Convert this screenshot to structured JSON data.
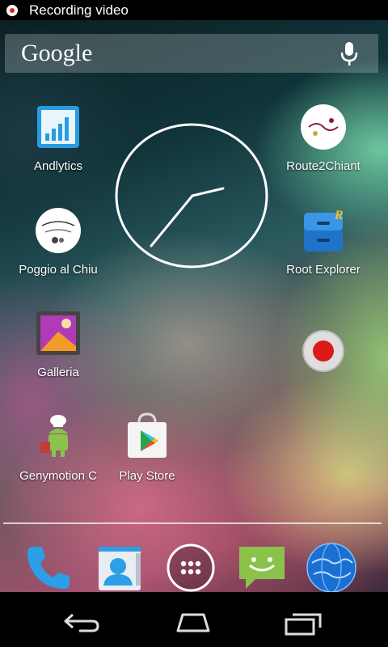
{
  "statusbar": {
    "recording_text": "Recording video"
  },
  "search": {
    "brand": "Google",
    "mic_icon": "microphone-icon"
  },
  "apps": [
    {
      "label": "Andlytics",
      "icon": "bar-chart-icon"
    },
    {
      "label": "Route2Chiant",
      "icon": "route2chianti-logo-icon"
    },
    {
      "label": "Poggio al Chiu",
      "icon": "poggio-al-chiuso-logo-icon"
    },
    {
      "label": "Root Explorer",
      "icon": "file-cabinet-icon"
    },
    {
      "label": "Galleria",
      "icon": "gallery-icon"
    },
    {
      "label": "Genymotion C",
      "icon": "android-chef-icon"
    },
    {
      "label": "Play Store",
      "icon": "play-store-icon"
    }
  ],
  "widgets": {
    "clock": "analog-clock",
    "record_button": "record-icon"
  },
  "dock": [
    {
      "name": "phone",
      "icon": "phone-icon"
    },
    {
      "name": "contacts",
      "icon": "contacts-icon"
    },
    {
      "name": "app-drawer",
      "icon": "app-drawer-icon"
    },
    {
      "name": "messaging",
      "icon": "messaging-icon"
    },
    {
      "name": "browser",
      "icon": "globe-icon"
    }
  ],
  "navbar": {
    "back": "back-icon",
    "home": "home-icon",
    "recents": "recents-icon"
  },
  "colors": {
    "record_red": "#e02020",
    "status_bg": "#000000",
    "play_green": "#2aa34a"
  }
}
